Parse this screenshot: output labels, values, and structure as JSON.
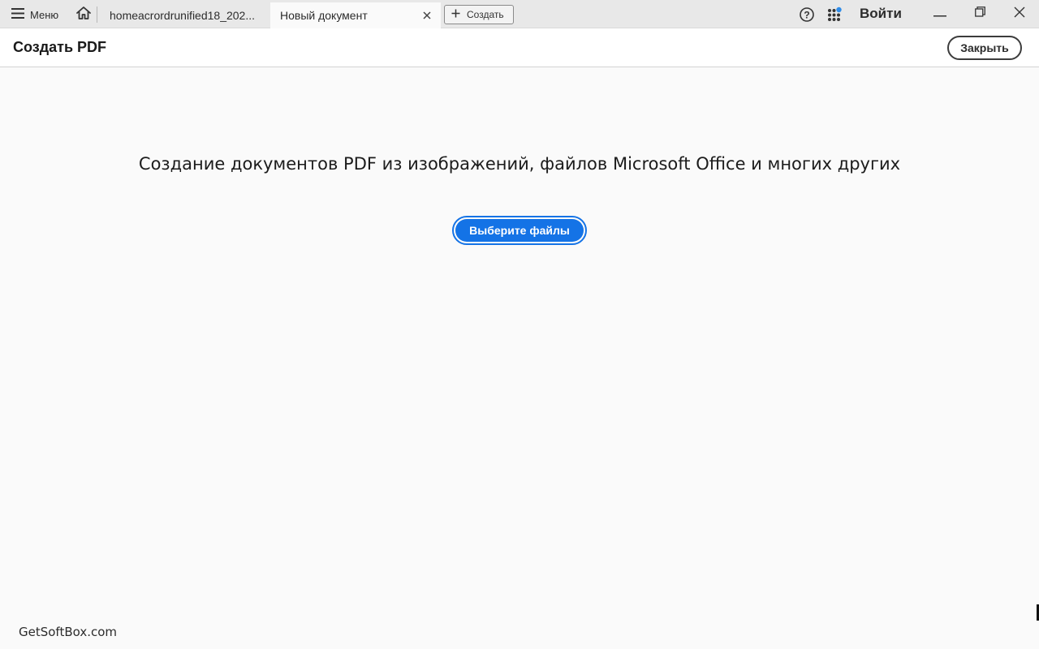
{
  "titlebar": {
    "menu_label": "Меню",
    "tabs": [
      {
        "label": "homeacrordrunified18_202...",
        "active": false
      },
      {
        "label": "Новый документ",
        "active": true
      }
    ],
    "create_label": "Создать",
    "signin_label": "Войти"
  },
  "header": {
    "title": "Создать PDF",
    "close_label": "Закрыть"
  },
  "main": {
    "headline": "Создание документов PDF из изображений, файлов Microsoft Office и многих других",
    "choose_label": "Выберите файлы"
  },
  "footer": {
    "watermark": "GetSoftBox.com"
  },
  "colors": {
    "accent": "#1473e6",
    "notification_dot": "#2f8ce8",
    "titlebar_bg": "#e8e8e8",
    "content_bg": "#fafafa"
  },
  "icons": {
    "menu": "hamburger-icon",
    "home": "home-icon",
    "tab_close": "close-icon",
    "create": "plus-icon",
    "help": "help-icon",
    "apps": "apps-grid-icon",
    "minimize": "minimize-icon",
    "maximize": "restore-icon",
    "window_close": "close-icon"
  }
}
